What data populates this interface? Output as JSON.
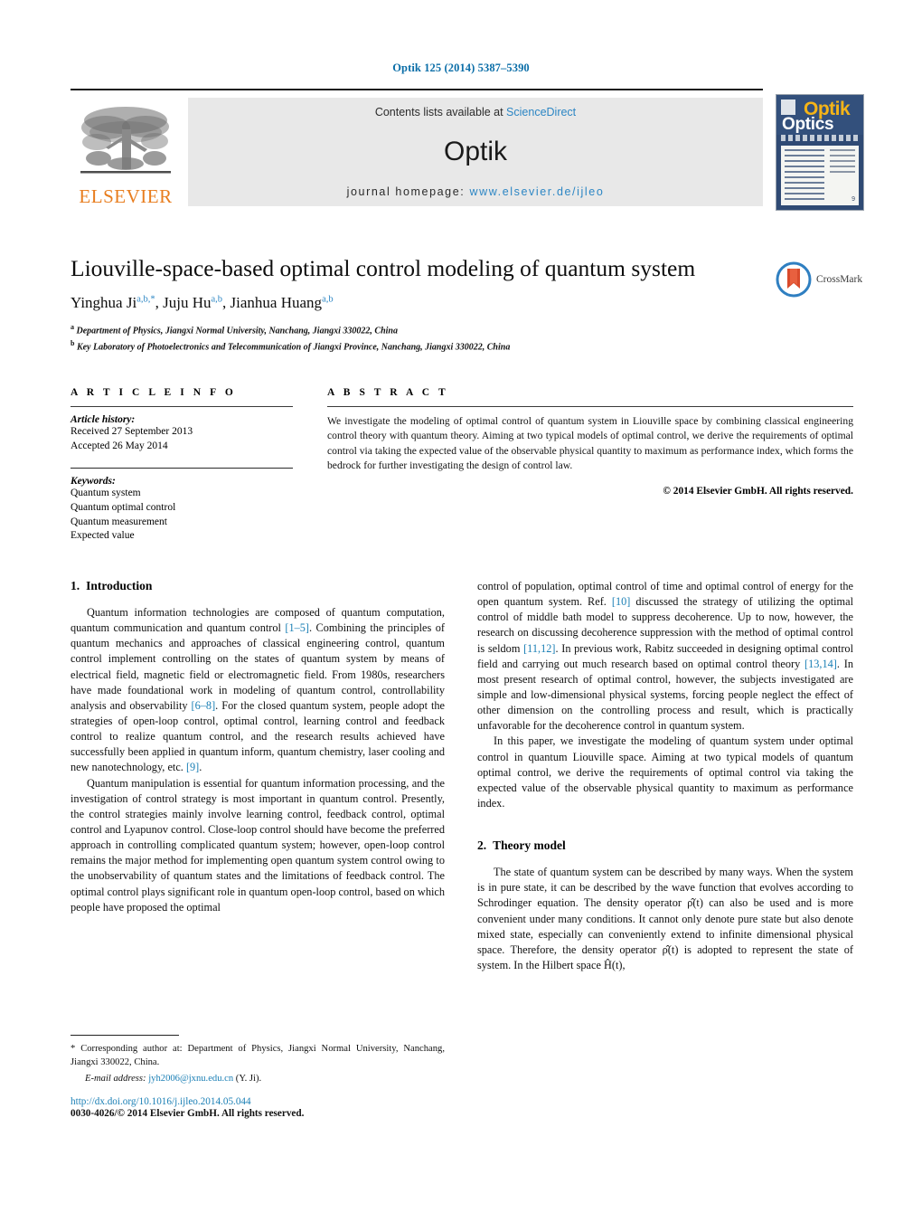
{
  "journal_ref": "Optik 125 (2014) 5387–5390",
  "masthead": {
    "contents_prefix": "Contents lists available at ",
    "contents_link": "ScienceDirect",
    "journal_name": "Optik",
    "homepage_prefix": "journal homepage: ",
    "homepage_link": "www.elsevier.de/ijleo",
    "publisher_logo_text": "ELSEVIER",
    "cover": {
      "title_primary": "Optik",
      "title_secondary": "Optics",
      "page_number": "9"
    }
  },
  "article": {
    "title": "Liouville-space-based optimal control modeling of quantum system",
    "authors": [
      {
        "name": "Yinghua Ji",
        "sup": "a,b,*"
      },
      {
        "name": "Juju Hu",
        "sup": "a,b"
      },
      {
        "name": "Jianhua Huang",
        "sup": "a,b"
      }
    ],
    "affiliations": [
      {
        "marker": "a",
        "text": "Department of Physics, Jiangxi Normal University, Nanchang, Jiangxi 330022, China"
      },
      {
        "marker": "b",
        "text": "Key Laboratory of Photoelectronics and Telecommunication of Jiangxi Province, Nanchang, Jiangxi 330022, China"
      }
    ],
    "crossmark_label": "CrossMark"
  },
  "article_info": {
    "heading": "A R T I C L E   I N F O",
    "history_label": "Article history:",
    "history": [
      "Received 27 September 2013",
      "Accepted 26 May 2014"
    ],
    "keywords_label": "Keywords:",
    "keywords": [
      "Quantum system",
      "Quantum optimal control",
      "Quantum measurement",
      "Expected value"
    ]
  },
  "abstract": {
    "heading": "A B S T R A C T",
    "text": "We investigate the modeling of optimal control of quantum system in Liouville space by combining classical engineering control theory with quantum theory. Aiming at two typical models of optimal control, we derive the requirements of optimal control via taking the expected value of the observable physical quantity to maximum as performance index, which forms the bedrock for further investigating the design of control law.",
    "copyright": "© 2014 Elsevier GmbH. All rights reserved."
  },
  "sections": {
    "intro": {
      "number": "1.",
      "title": "Introduction",
      "paragraph1_a": "Quantum information technologies are composed of quantum computation, quantum communication and quantum control ",
      "paragraph1_cite1": "[1–5]",
      "paragraph1_b": ". Combining the principles of quantum mechanics and approaches of classical engineering control, quantum control implement controlling on the states of quantum system by means of electrical field, magnetic field or electromagnetic field. From 1980s, researchers have made foundational work in modeling of quantum control, controllability analysis and observability ",
      "paragraph1_cite2": "[6–8]",
      "paragraph1_c": ". For the closed quantum system, people adopt the strategies of open-loop control, optimal control, learning control and feedback control to realize quantum control, and the research results achieved have successfully been applied in quantum inform, quantum chemistry, laser cooling and new nanotechnology, etc. ",
      "paragraph1_cite3": "[9]",
      "paragraph1_d": ".",
      "paragraph2": "Quantum manipulation is essential for quantum information processing, and the investigation of control strategy is most important in quantum control. Presently, the control strategies mainly involve learning control, feedback control, optimal control and Lyapunov control. Close-loop control should have become the preferred approach in controlling complicated quantum system; however, open-loop control remains the major method for implementing open quantum system control owing to the unobservability of quantum states and the limitations of feedback control. The optimal control plays significant role in quantum open-loop control, based on which people have proposed the optimal",
      "paragraph3_a": "control of population, optimal control of time and optimal control of energy for the open quantum system. Ref. ",
      "paragraph3_cite1": "[10]",
      "paragraph3_b": " discussed the strategy of utilizing the optimal control of middle bath model to suppress decoherence. Up to now, however, the research on discussing decoherence suppression with the method of optimal control is seldom ",
      "paragraph3_cite2": "[11,12]",
      "paragraph3_c": ". In previous work, Rabitz succeeded in designing optimal control field and carrying out much research based on optimal control theory ",
      "paragraph3_cite3": "[13,14]",
      "paragraph3_d": ". In most present research of optimal control, however, the subjects investigated are simple and low-dimensional physical systems, forcing people neglect the effect of other dimension on the controlling process and result, which is practically unfavorable for the decoherence control in quantum system.",
      "paragraph4": "In this paper, we investigate the modeling of quantum system under optimal control in quantum Liouville space. Aiming at two typical models of quantum optimal control, we derive the requirements of optimal control via taking the expected value of the observable physical quantity to maximum as performance index."
    },
    "theory": {
      "number": "2.",
      "title": "Theory model",
      "paragraph1": "The state of quantum system can be described by many ways. When the system is in pure state, it can be described by the wave function that evolves according to Schrodinger equation. The density operator ρ̂(t) can also be used and is more convenient under many conditions. It cannot only denote pure state but also denote mixed state, especially can conveniently extend to infinite dimensional physical space. Therefore, the density operator ρ̂(t) is adopted to represent the state of system. In the Hilbert space Ĥ(t),"
    }
  },
  "footnotes": {
    "corresponding": "* Corresponding author at: Department of Physics, Jiangxi Normal University, Nanchang, Jiangxi 330022, China.",
    "email_label": "E-mail address: ",
    "email": "jyh2006@jxnu.edu.cn",
    "email_suffix": " (Y. Ji).",
    "doi": "http://dx.doi.org/10.1016/j.ijleo.2014.05.044",
    "issn_line": "0030-4026/© 2014 Elsevier GmbH. All rights reserved."
  },
  "colors": {
    "link_blue": "#1a7fb5",
    "header_blue": "#0b6ea8",
    "elsevier_orange": "#e87d1e"
  }
}
